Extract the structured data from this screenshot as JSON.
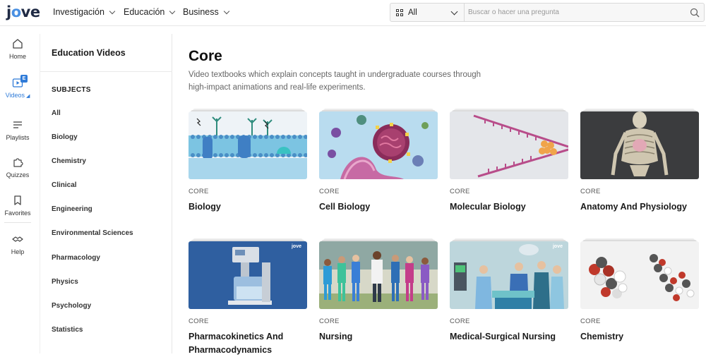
{
  "header": {
    "logo": {
      "prefix": "j",
      "accent": "o",
      "suffix": "ve"
    },
    "nav": [
      {
        "label": "Investigación"
      },
      {
        "label": "Educación"
      },
      {
        "label": "Business"
      }
    ],
    "search": {
      "scope_value": "All",
      "placeholder": "Buscar o hacer una pregunta"
    }
  },
  "rail": {
    "items": [
      {
        "label": "Home",
        "icon": "home-icon"
      },
      {
        "label": "Videos",
        "icon": "video-icon",
        "badge": "E",
        "active": true
      },
      {
        "label": "Playlists",
        "icon": "playlist-icon"
      },
      {
        "label": "Quizzes",
        "icon": "puzzle-icon"
      },
      {
        "label": "Favorites",
        "icon": "bookmark-icon"
      },
      {
        "label": "Help",
        "icon": "handshake-icon"
      }
    ]
  },
  "sidebar": {
    "title": "Education Videos",
    "section_label": "SUBJECTS",
    "items": [
      "All",
      "Biology",
      "Chemistry",
      "Clinical",
      "Engineering",
      "Environmental Sciences",
      "Pharmacology",
      "Physics",
      "Psychology",
      "Statistics"
    ]
  },
  "main": {
    "title": "Core",
    "description": "Video textbooks which explain concepts taught in undergraduate courses through high-impact animations and real-life experiments.",
    "cards": [
      {
        "kicker": "CORE",
        "title": "Biology"
      },
      {
        "kicker": "CORE",
        "title": "Cell Biology"
      },
      {
        "kicker": "CORE",
        "title": "Molecular Biology"
      },
      {
        "kicker": "CORE",
        "title": "Anatomy And Physiology"
      },
      {
        "kicker": "CORE",
        "title": "Pharmacokinetics And Pharmacodynamics"
      },
      {
        "kicker": "CORE",
        "title": "Nursing"
      },
      {
        "kicker": "CORE",
        "title": "Medical-Surgical Nursing"
      },
      {
        "kicker": "CORE",
        "title": "Chemistry"
      }
    ],
    "thumb_watermark": "jove"
  },
  "colors": {
    "accent": "#2f7bd8",
    "logo_text": "#1f2a44"
  }
}
